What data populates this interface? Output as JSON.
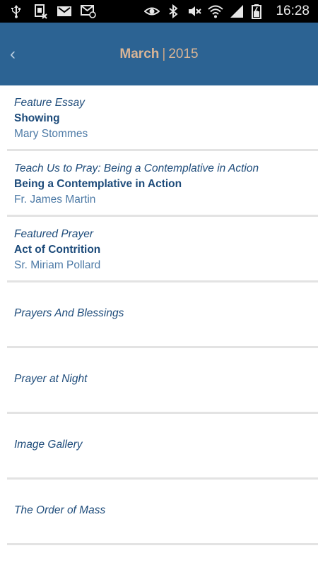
{
  "status_bar": {
    "time": "16:28",
    "left_icons": [
      "usb-icon",
      "sim-icon",
      "gmail-icon",
      "email-icon"
    ],
    "right_icons": [
      "eye-icon",
      "bluetooth-icon",
      "mute-icon",
      "wifi-icon",
      "signal-icon",
      "battery-icon"
    ]
  },
  "header": {
    "back_glyph": "‹",
    "month": "March",
    "separator": "|",
    "year": "2015",
    "background": "#2c6393",
    "accent": "#d9b596"
  },
  "items": [
    {
      "kicker": "Feature Essay",
      "title": "Showing",
      "author": "Mary Stommes"
    },
    {
      "kicker": "Teach Us to Pray: Being a Contemplative in Action",
      "title": "Being a Contemplative in Action",
      "author": "Fr. James Martin"
    },
    {
      "kicker": "Featured Prayer",
      "title": "Act of Contrition",
      "author": "Sr. Miriam Pollard"
    },
    {
      "kicker": "Prayers And Blessings"
    },
    {
      "kicker": "Prayer at Night"
    },
    {
      "kicker": "Image Gallery"
    },
    {
      "kicker": "The Order of Mass"
    }
  ]
}
